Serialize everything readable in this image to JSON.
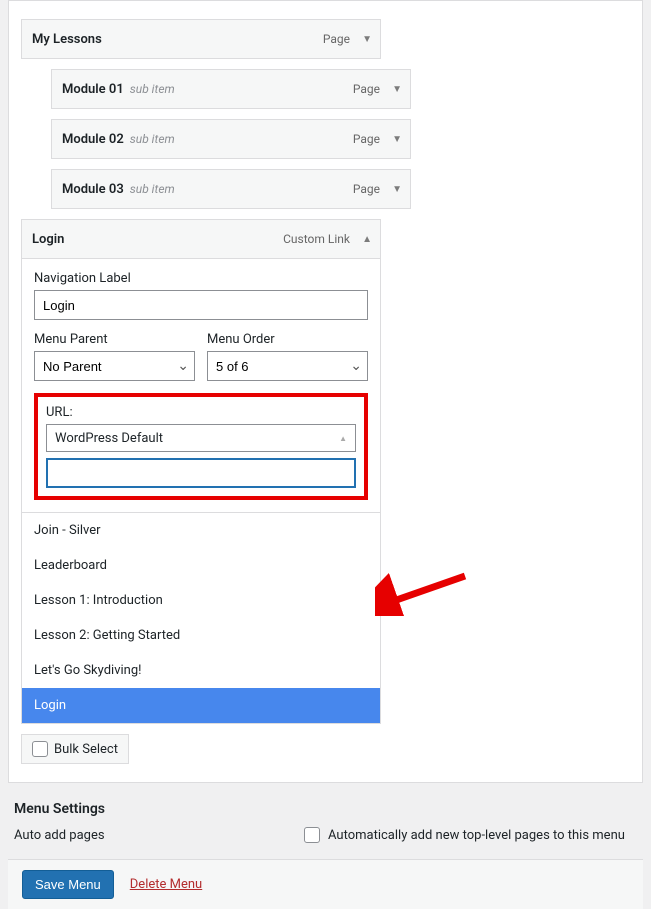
{
  "accent": "#e60000",
  "highlight": "#4787ed",
  "menu_items": {
    "root": {
      "title": "My Lessons",
      "type": "Page"
    },
    "children": [
      {
        "title": "Module 01",
        "sub": "sub item",
        "type": "Page"
      },
      {
        "title": "Module 02",
        "sub": "sub item",
        "type": "Page"
      },
      {
        "title": "Module 03",
        "sub": "sub item",
        "type": "Page"
      }
    ],
    "expanded": {
      "title": "Login",
      "type": "Custom Link"
    }
  },
  "edit": {
    "nav_label_field": "Navigation Label",
    "nav_label_value": "Login",
    "parent_label": "Menu Parent",
    "parent_value": "No Parent",
    "order_label": "Menu Order",
    "order_value": "5 of 6",
    "url_label": "URL:",
    "url_selected": "WordPress Default",
    "url_search": ""
  },
  "dropdown_options": [
    {
      "label": "Join - Silver",
      "selected": false
    },
    {
      "label": "Leaderboard",
      "selected": false
    },
    {
      "label": "Lesson 1: Introduction",
      "selected": false
    },
    {
      "label": "Lesson 2: Getting Started",
      "selected": false
    },
    {
      "label": "Let's Go Skydiving!",
      "selected": false
    },
    {
      "label": "Login",
      "selected": true
    }
  ],
  "bulk_select_label": "Bulk Select",
  "settings": {
    "heading": "Menu Settings",
    "auto_add_label": "Auto add pages",
    "auto_add_text": "Automatically add new top-level pages to this menu",
    "auto_add_checked": false
  },
  "footer": {
    "save": "Save Menu",
    "delete": "Delete Menu"
  }
}
